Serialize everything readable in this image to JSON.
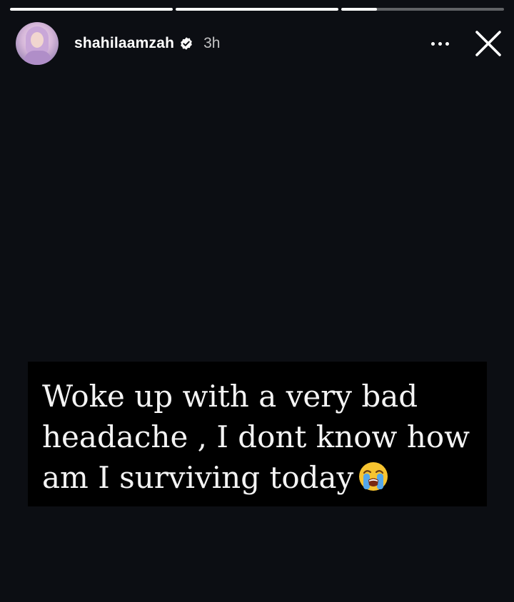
{
  "story": {
    "progress": [
      {
        "fill": 1.0
      },
      {
        "fill": 1.0
      },
      {
        "fill": 0.22
      }
    ],
    "user": {
      "username": "shahilaamzah",
      "verified": true,
      "posted_ago": "3h",
      "avatar_icon": "profile-avatar"
    },
    "actions": {
      "more_icon": "more-horizontal-icon",
      "close_icon": "close-icon"
    },
    "caption": {
      "lines": [
        "Woke up with a very bad",
        "headache , I dont know how",
        "am I surviving today"
      ],
      "emoji": "loudly-crying-face"
    },
    "colors": {
      "background": "#0c0e13",
      "caption_bg": "#000000",
      "text": "#f4f4f4",
      "progress_track": "#595b60",
      "progress_fill": "#ffffff"
    }
  }
}
